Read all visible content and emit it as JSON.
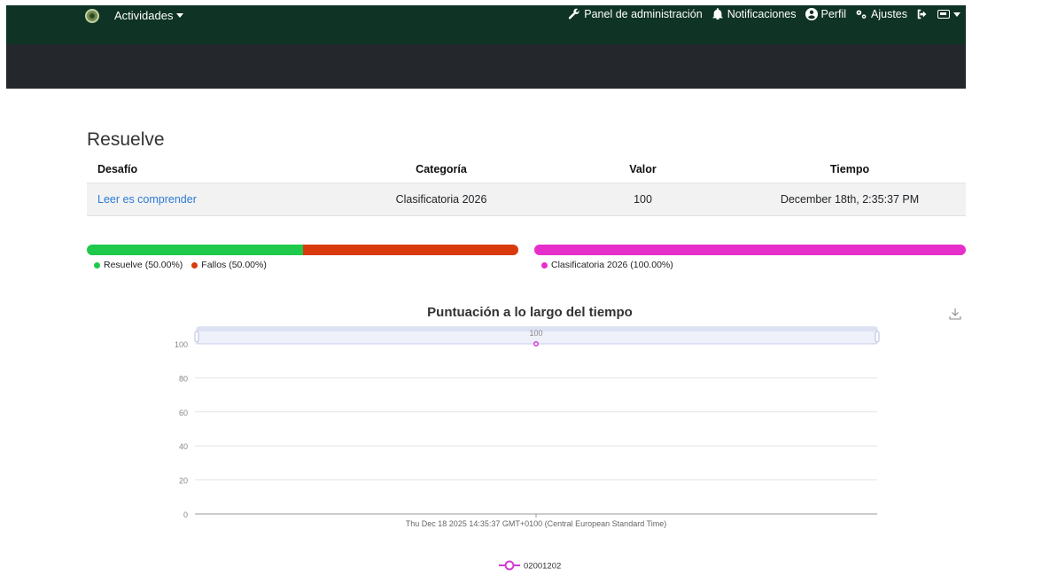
{
  "nav": {
    "activities_label": "Actividades",
    "admin_label": "Panel de administración",
    "notifications_label": "Notificaciones",
    "profile_label": "Perfil",
    "settings_label": "Ajustes"
  },
  "page": {
    "title": "Resuelve"
  },
  "table": {
    "headers": [
      "Desafío",
      "Categoría",
      "Valor",
      "Tiempo"
    ],
    "rows": [
      {
        "challenge": "Leer es comprender",
        "category": "Clasificatoria 2026",
        "value": "100",
        "time": "December 18th, 2:35:37 PM"
      }
    ]
  },
  "solves_bar": {
    "items": [
      {
        "label": "Resuelve (50.00%)",
        "fraction": 0.5,
        "color": "#1ec94b"
      },
      {
        "label": "Fallos (50.00%)",
        "fraction": 0.5,
        "color": "#d83a0e"
      }
    ]
  },
  "category_bar": {
    "items": [
      {
        "label": "Clasificatoria 2026 (100.00%)",
        "fraction": 1.0,
        "color": "#e62ecb"
      }
    ]
  },
  "chart_data": {
    "type": "line",
    "title": "Puntuación a lo largo del tiempo",
    "x": [
      "Thu Dec 18 2025 14:35:37 GMT+0100 (Central European Standard Time)"
    ],
    "series": [
      {
        "name": "02001202",
        "values": [
          100
        ],
        "color": "#d23bd6"
      }
    ],
    "ylim": [
      0,
      100
    ],
    "yticks": [
      0,
      20,
      40,
      60,
      80,
      100
    ],
    "data_label": "100",
    "grid": true,
    "legend": "bottom-center"
  }
}
